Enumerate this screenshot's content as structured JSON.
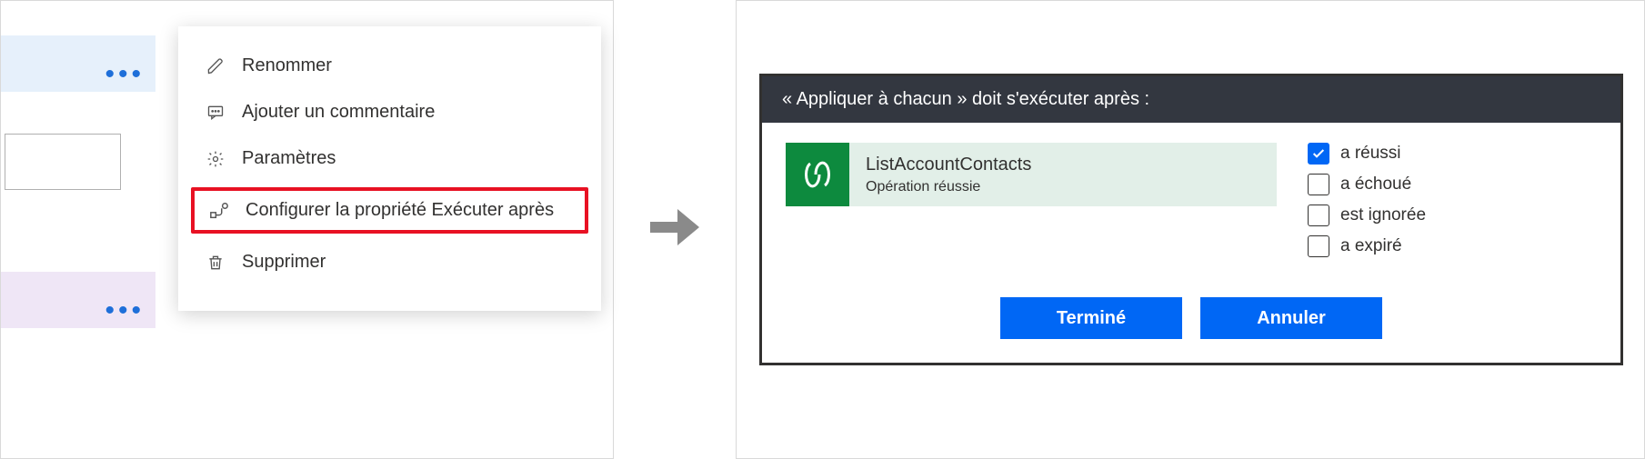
{
  "left": {
    "menu": {
      "rename": "Renommer",
      "comment": "Ajouter un commentaire",
      "settings": "Paramètres",
      "runafter": "Configurer la propriété Exécuter après",
      "delete": "Supprimer"
    }
  },
  "right": {
    "dialog": {
      "title": "« Appliquer à chacun » doit s'exécuter après :",
      "operation": {
        "name": "ListAccountContacts",
        "status": "Opération réussie"
      },
      "checks": {
        "succeeded": "a réussi",
        "failed": "a échoué",
        "skipped": "est ignorée",
        "timedout": "a expiré"
      },
      "actions": {
        "done": "Terminé",
        "cancel": "Annuler"
      }
    }
  }
}
